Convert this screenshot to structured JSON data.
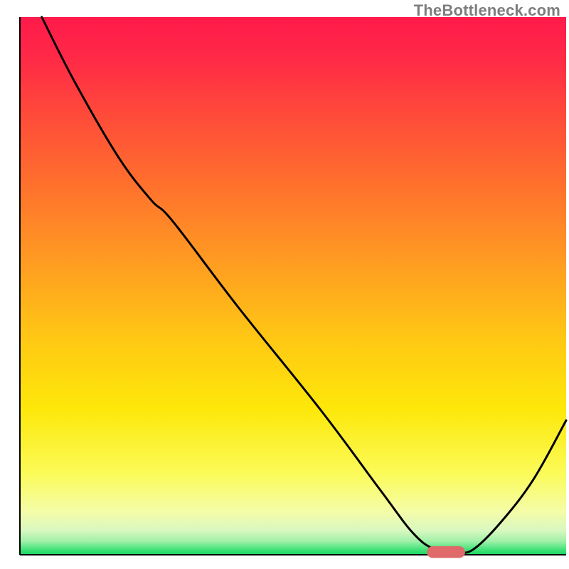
{
  "watermark": "TheBottleneck.com",
  "chart_data": {
    "type": "line",
    "title": "",
    "xlabel": "",
    "ylabel": "",
    "xlim": [
      0,
      100
    ],
    "ylim": [
      0,
      100
    ],
    "background_gradient": {
      "stops": [
        {
          "offset": 0.0,
          "color": "#ff1a4b"
        },
        {
          "offset": 0.08,
          "color": "#ff2a46"
        },
        {
          "offset": 0.18,
          "color": "#ff4a3a"
        },
        {
          "offset": 0.3,
          "color": "#ff6d2e"
        },
        {
          "offset": 0.45,
          "color": "#ff9a22"
        },
        {
          "offset": 0.6,
          "color": "#ffc814"
        },
        {
          "offset": 0.73,
          "color": "#fde80a"
        },
        {
          "offset": 0.85,
          "color": "#fbfb5a"
        },
        {
          "offset": 0.92,
          "color": "#f4fca8"
        },
        {
          "offset": 0.955,
          "color": "#d8f8c0"
        },
        {
          "offset": 0.975,
          "color": "#9ff0a8"
        },
        {
          "offset": 0.99,
          "color": "#45e37a"
        },
        {
          "offset": 1.0,
          "color": "#17d65e"
        }
      ]
    },
    "series": [
      {
        "name": "bottleneck-curve",
        "color": "#000000",
        "x": [
          4,
          10,
          18,
          24,
          28,
          40,
          55,
          66,
          72,
          76,
          80,
          83,
          88,
          94,
          100
        ],
        "y": [
          100,
          88,
          74,
          66,
          62,
          46,
          27,
          12,
          4,
          1,
          0.5,
          1,
          6,
          14,
          25
        ]
      }
    ],
    "marker": {
      "name": "optimal-range",
      "shape": "pill",
      "color": "#e06a6a",
      "x_center": 78,
      "y": 0.5,
      "width": 7,
      "height": 2.2
    },
    "axes": {
      "color": "#000000",
      "thickness_px": 2
    }
  }
}
